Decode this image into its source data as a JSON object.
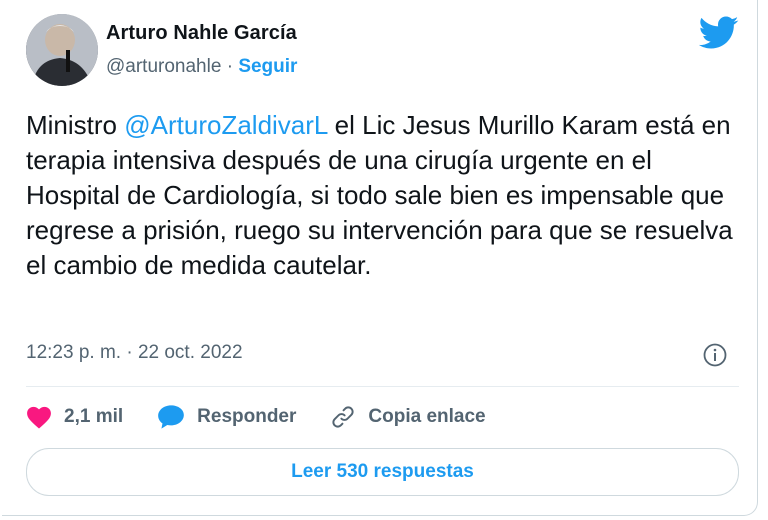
{
  "tweet": {
    "author_name": "Arturo Nahle García",
    "handle": "@arturonahle",
    "separator": "·",
    "follow_label": "Seguir",
    "text_before": "Ministro ",
    "mention": "@ArturoZaldivarL",
    "text_after": " el Lic Jesus Murillo Karam está en terapia intensiva después de una cirugía urgente en el Hospital de Cardiología, si todo sale bien es impensable que regrese a prisión, ruego su intervención para que se resuelva el cambio de medida cautelar.",
    "timestamp": "12:23 p. m. · 22 oct. 2022"
  },
  "actions": {
    "likes": "2,1 mil",
    "reply_label": "Responder",
    "copy_link_label": "Copia enlace"
  },
  "read_replies_label": "Leer 530 respuestas",
  "icons": {
    "brand": "twitter-bird-icon",
    "info": "info-icon",
    "like": "heart-icon",
    "reply": "speech-bubble-icon",
    "link": "link-icon"
  },
  "colors": {
    "brand_blue": "#1d9bf0",
    "like_pink": "#f91880",
    "secondary_text": "#536471"
  }
}
